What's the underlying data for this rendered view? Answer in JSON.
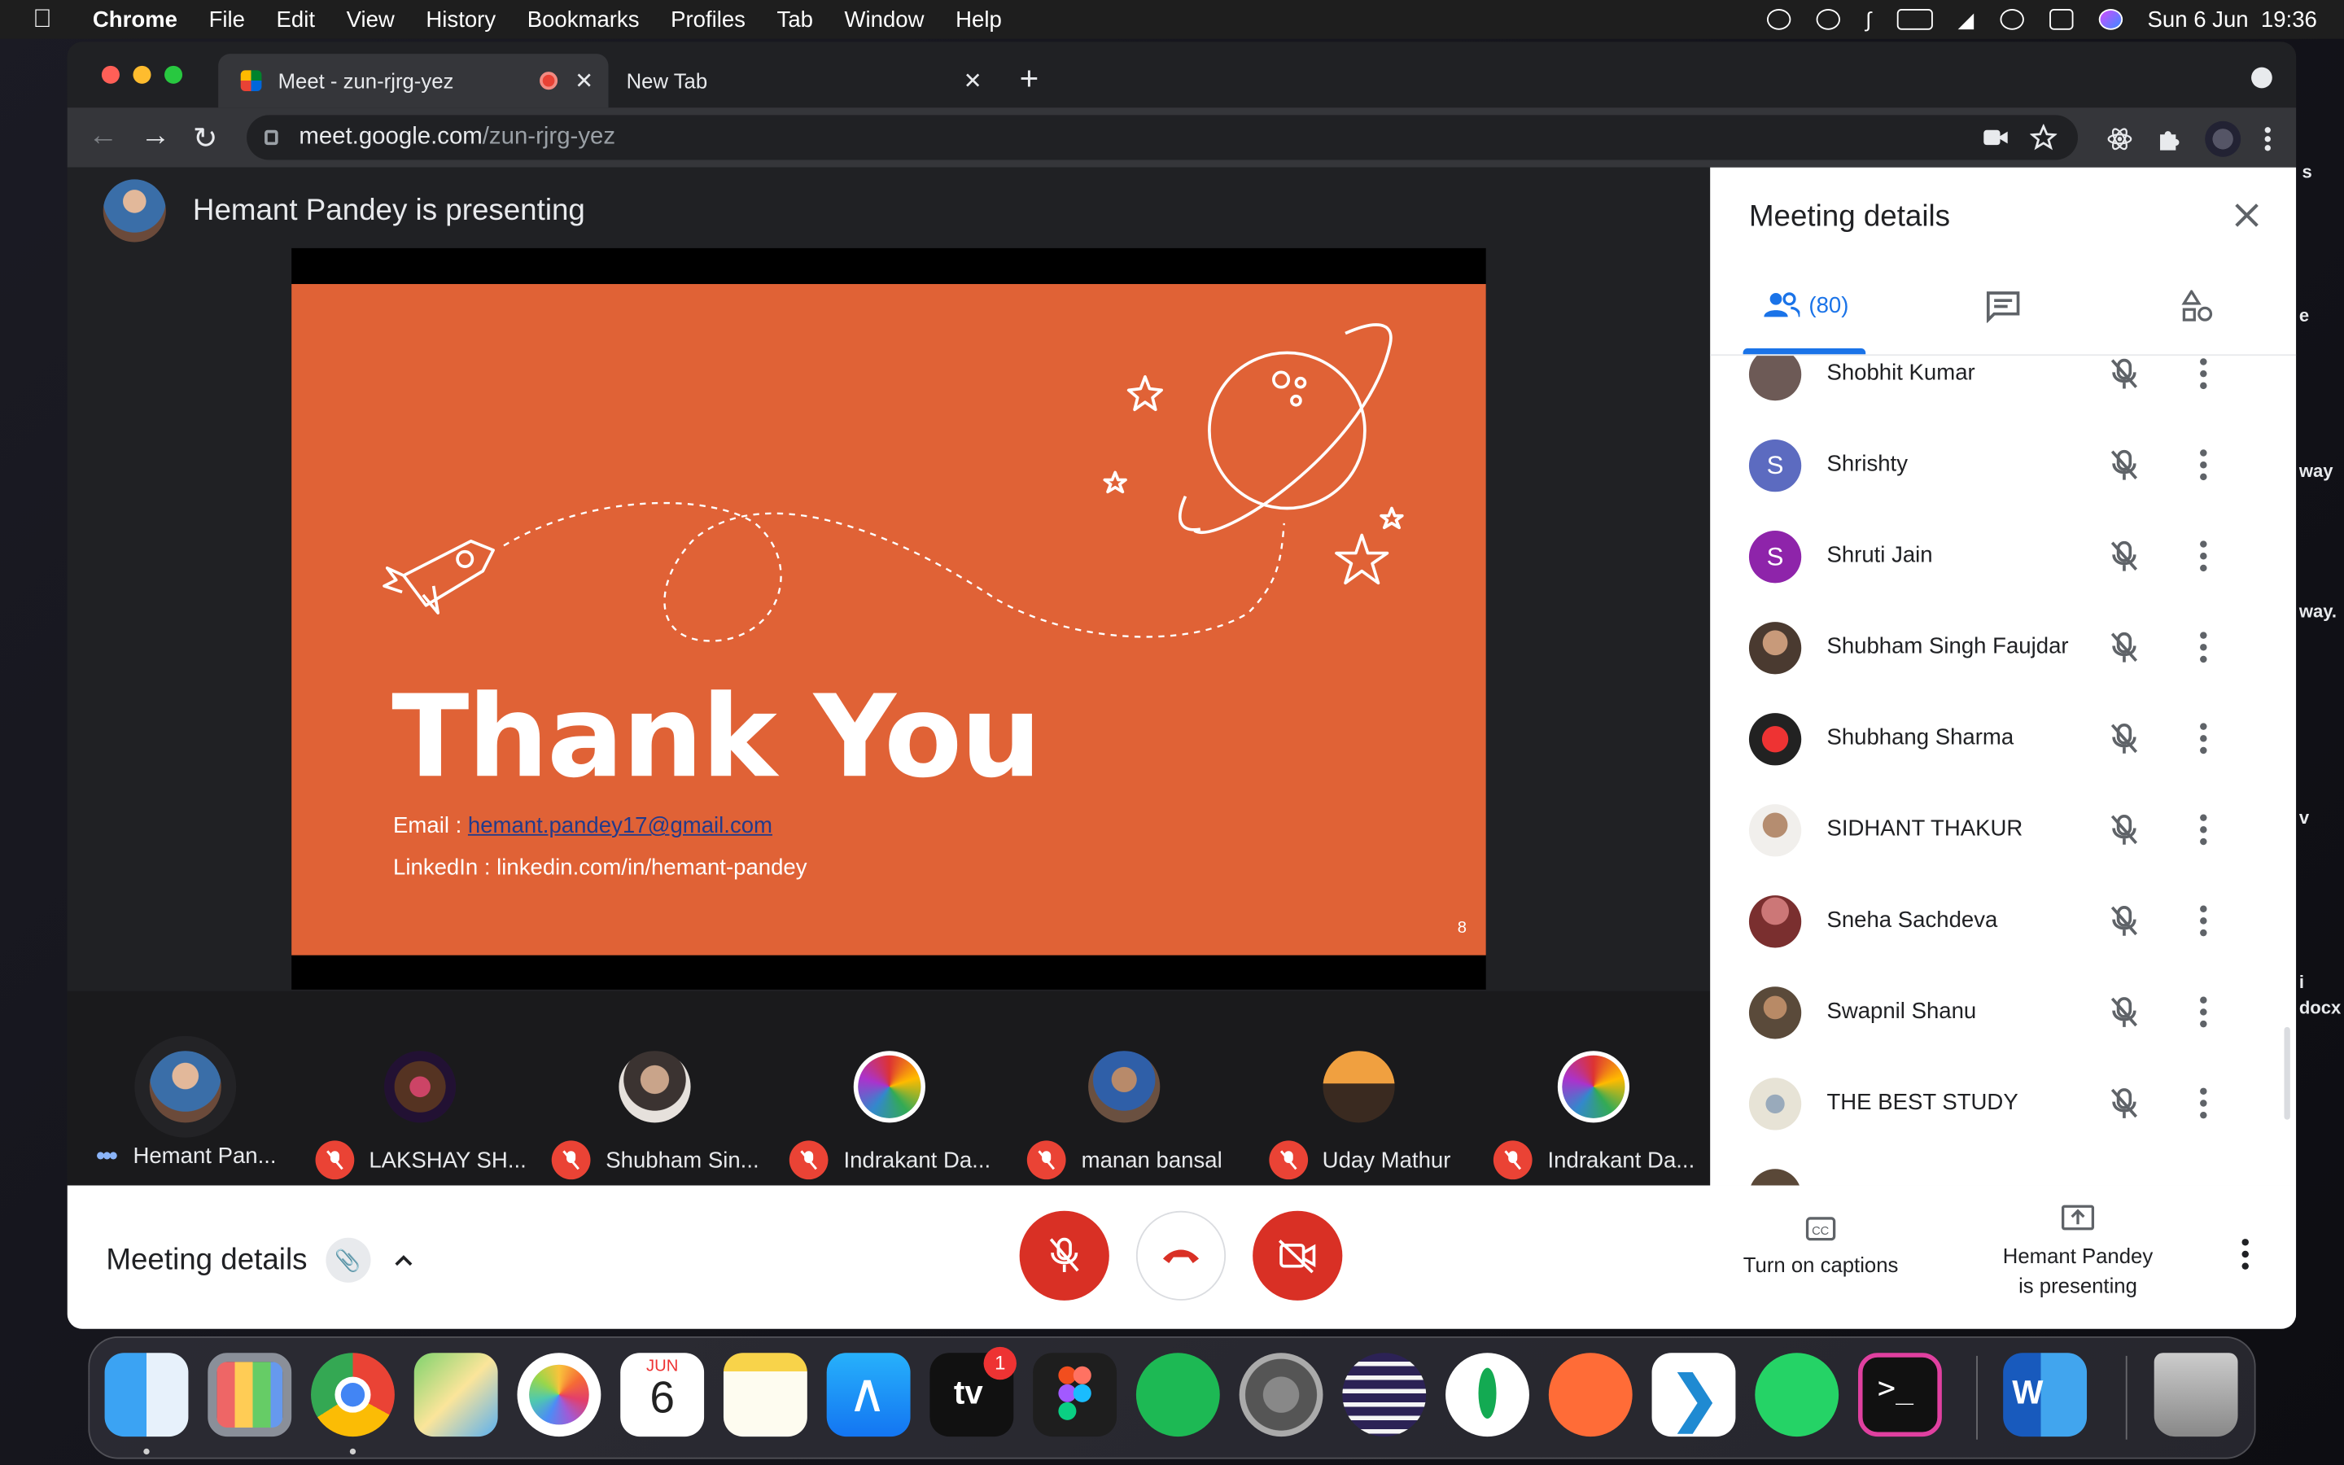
{
  "menubar": {
    "app": "Chrome",
    "items": [
      "File",
      "Edit",
      "View",
      "History",
      "Bookmarks",
      "Profiles",
      "Tab",
      "Window",
      "Help"
    ],
    "clock": "Sun 6 Jun  19:36"
  },
  "browser": {
    "tabs": [
      {
        "title": "Meet - zun-rjrg-yez",
        "active": true,
        "recording": true
      },
      {
        "title": "New Tab",
        "active": false
      }
    ],
    "url_host": "meet.google.com",
    "url_path": "/zun-rjrg-yez"
  },
  "meet": {
    "presenter_text": "Hemant Pandey is presenting",
    "slide": {
      "title": "Thank You",
      "email_label": "Email : ",
      "email_link": "hemant.pandey17@gmail.com",
      "linkedin": "LinkedIn : linkedin.com/in/hemant-pandey",
      "page_number": "8",
      "background": "#e06236"
    },
    "filmstrip": [
      {
        "name": "Hemant Pan...",
        "muted": false,
        "speaking": true
      },
      {
        "name": "LAKSHAY SH...",
        "muted": true
      },
      {
        "name": "Shubham Sin...",
        "muted": true
      },
      {
        "name": "Indrakant Da...",
        "muted": true
      },
      {
        "name": "manan bansal",
        "muted": true
      },
      {
        "name": "Uday Mathur",
        "muted": true
      },
      {
        "name": "Indrakant Da...",
        "muted": true
      }
    ],
    "panel": {
      "title": "Meeting details",
      "people_count": "(80)",
      "participants": [
        {
          "name": "Shobhit Kumar",
          "initial": "",
          "color": "#6d5a56"
        },
        {
          "name": "Shrishty",
          "initial": "S",
          "color": "#5c6bc0"
        },
        {
          "name": "Shruti Jain",
          "initial": "S",
          "color": "#8e24aa"
        },
        {
          "name": "Shubham Singh Faujdar",
          "initial": "",
          "color": "#7a6151"
        },
        {
          "name": "Shubhang Sharma",
          "initial": "",
          "color": "#b71c1c"
        },
        {
          "name": "SIDHANT THAKUR",
          "initial": "",
          "color": "#8d7b6a"
        },
        {
          "name": "Sneha Sachdeva",
          "initial": "",
          "color": "#8b3a3a"
        },
        {
          "name": "Swapnil Shanu",
          "initial": "",
          "color": "#6a5a4a"
        },
        {
          "name": "THE BEST STUDY",
          "initial": "",
          "color": "#e7e3d6"
        }
      ]
    },
    "bottom": {
      "meeting_details": "Meeting details",
      "captions": "Turn on captions",
      "presenting_line1": "Hemant Pandey",
      "presenting_line2": "is presenting"
    }
  },
  "dock": {
    "calendar_month": "JUN",
    "calendar_day": "6",
    "tv_badge": "1",
    "tv_label": "tv"
  },
  "background_window_text": [
    "s",
    "e",
    "way",
    "way.",
    "v",
    "i",
    "docx"
  ],
  "colors": {
    "meet_red": "#d93025",
    "accent_blue": "#1a73e8"
  }
}
